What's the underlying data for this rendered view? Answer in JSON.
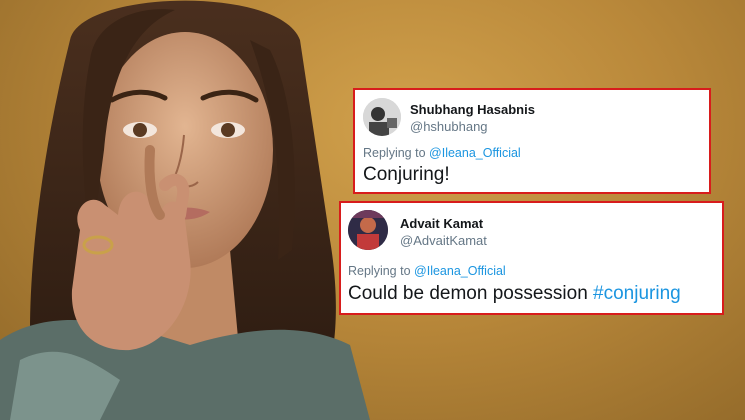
{
  "tweets": [
    {
      "name": "Shubhang Hasabnis",
      "handle": "@hshubhang",
      "reply_prefix": "Replying to",
      "reply_mention": "@Ileana_Official",
      "text": "Conjuring!",
      "avatar_icon": "user-avatar-photo"
    },
    {
      "name": "Advait Kamat",
      "handle": "@AdvaitKamat",
      "reply_prefix": "Replying to",
      "reply_mention": "@Ileana_Official",
      "text": "Could be demon possession",
      "hashtag": "#conjuring",
      "avatar_icon": "user-avatar-photo"
    }
  ],
  "colors": {
    "border": "#d81c1c",
    "link": "#1b95e0",
    "muted": "#657786",
    "text": "#14171a"
  }
}
